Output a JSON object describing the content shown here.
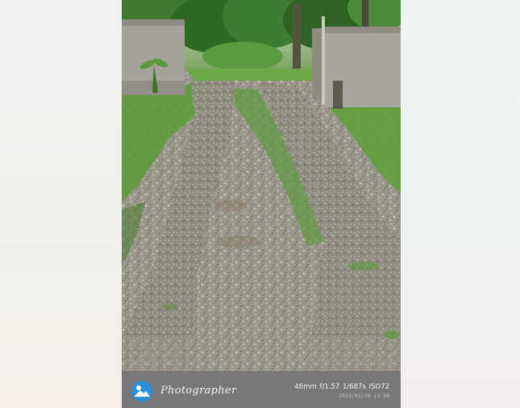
{
  "watermark": {
    "brand": "Photographer",
    "exif": "46mm  f/1.57  1/687s  ISO72",
    "timestamp": "2023/02/20 13:50"
  },
  "scene": {
    "subject": "gravel driveway between two concrete gateposts"
  },
  "colors": {
    "footer_bg": "#787878",
    "logo_blue": "#2b8fd9",
    "grass": "#5fa03a",
    "wall": "#a6a49a"
  }
}
